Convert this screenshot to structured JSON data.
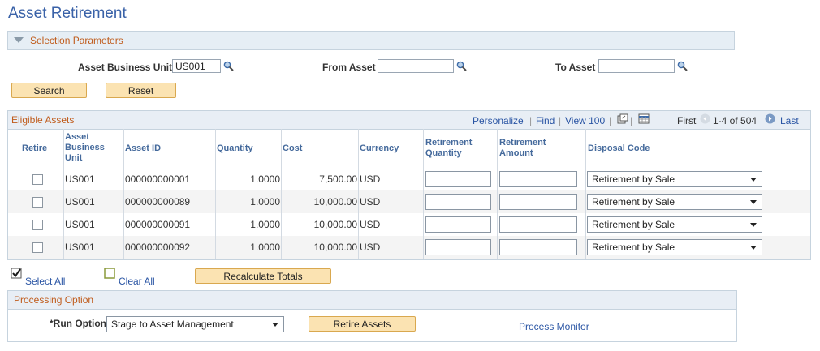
{
  "page": {
    "title": "Asset Retirement"
  },
  "selection": {
    "header": "Selection Parameters",
    "business_unit_label": "Asset Business Unit",
    "business_unit_value": "US001",
    "from_asset_label": "From Asset",
    "from_asset_value": "",
    "to_asset_label": "To Asset",
    "to_asset_value": "",
    "search_label": "Search",
    "reset_label": "Reset"
  },
  "grid": {
    "title": "Eligible Assets",
    "personalize": "Personalize",
    "find": "Find",
    "view100": "View 100",
    "first": "First",
    "range": "1-4 of 504",
    "last": "Last",
    "headers": {
      "retire": "Retire",
      "bu_line1": "Asset",
      "bu_line2": "Business",
      "bu_line3": "Unit",
      "asset_id": "Asset ID",
      "quantity": "Quantity",
      "cost": "Cost",
      "currency": "Currency",
      "ret_qty_line1": "Retirement",
      "ret_qty_line2": "Quantity",
      "ret_amt_line1": "Retirement",
      "ret_amt_line2": "Amount",
      "disposal": "Disposal Code"
    },
    "rows": [
      {
        "bu": "US001",
        "asset_id": "000000000001",
        "quantity": "1.0000",
        "cost": "7,500.00",
        "currency": "USD",
        "disposal": "Retirement by Sale"
      },
      {
        "bu": "US001",
        "asset_id": "000000000089",
        "quantity": "1.0000",
        "cost": "10,000.00",
        "currency": "USD",
        "disposal": "Retirement by Sale"
      },
      {
        "bu": "US001",
        "asset_id": "000000000091",
        "quantity": "1.0000",
        "cost": "10,000.00",
        "currency": "USD",
        "disposal": "Retirement by Sale"
      },
      {
        "bu": "US001",
        "asset_id": "000000000092",
        "quantity": "1.0000",
        "cost": "10,000.00",
        "currency": "USD",
        "disposal": "Retirement by Sale"
      }
    ]
  },
  "actions": {
    "select_all": "Select All",
    "clear_all": "Clear All",
    "recalc": "Recalculate Totals"
  },
  "processing": {
    "header": "Processing Option",
    "run_option_label": "*Run Option",
    "run_option_value": "Stage to Asset Management",
    "retire_label": "Retire Assets",
    "process_monitor": "Process Monitor"
  },
  "colors": {
    "link": "#2a55a4",
    "section_title": "#c05c1c",
    "button": "#fbe3b2"
  }
}
